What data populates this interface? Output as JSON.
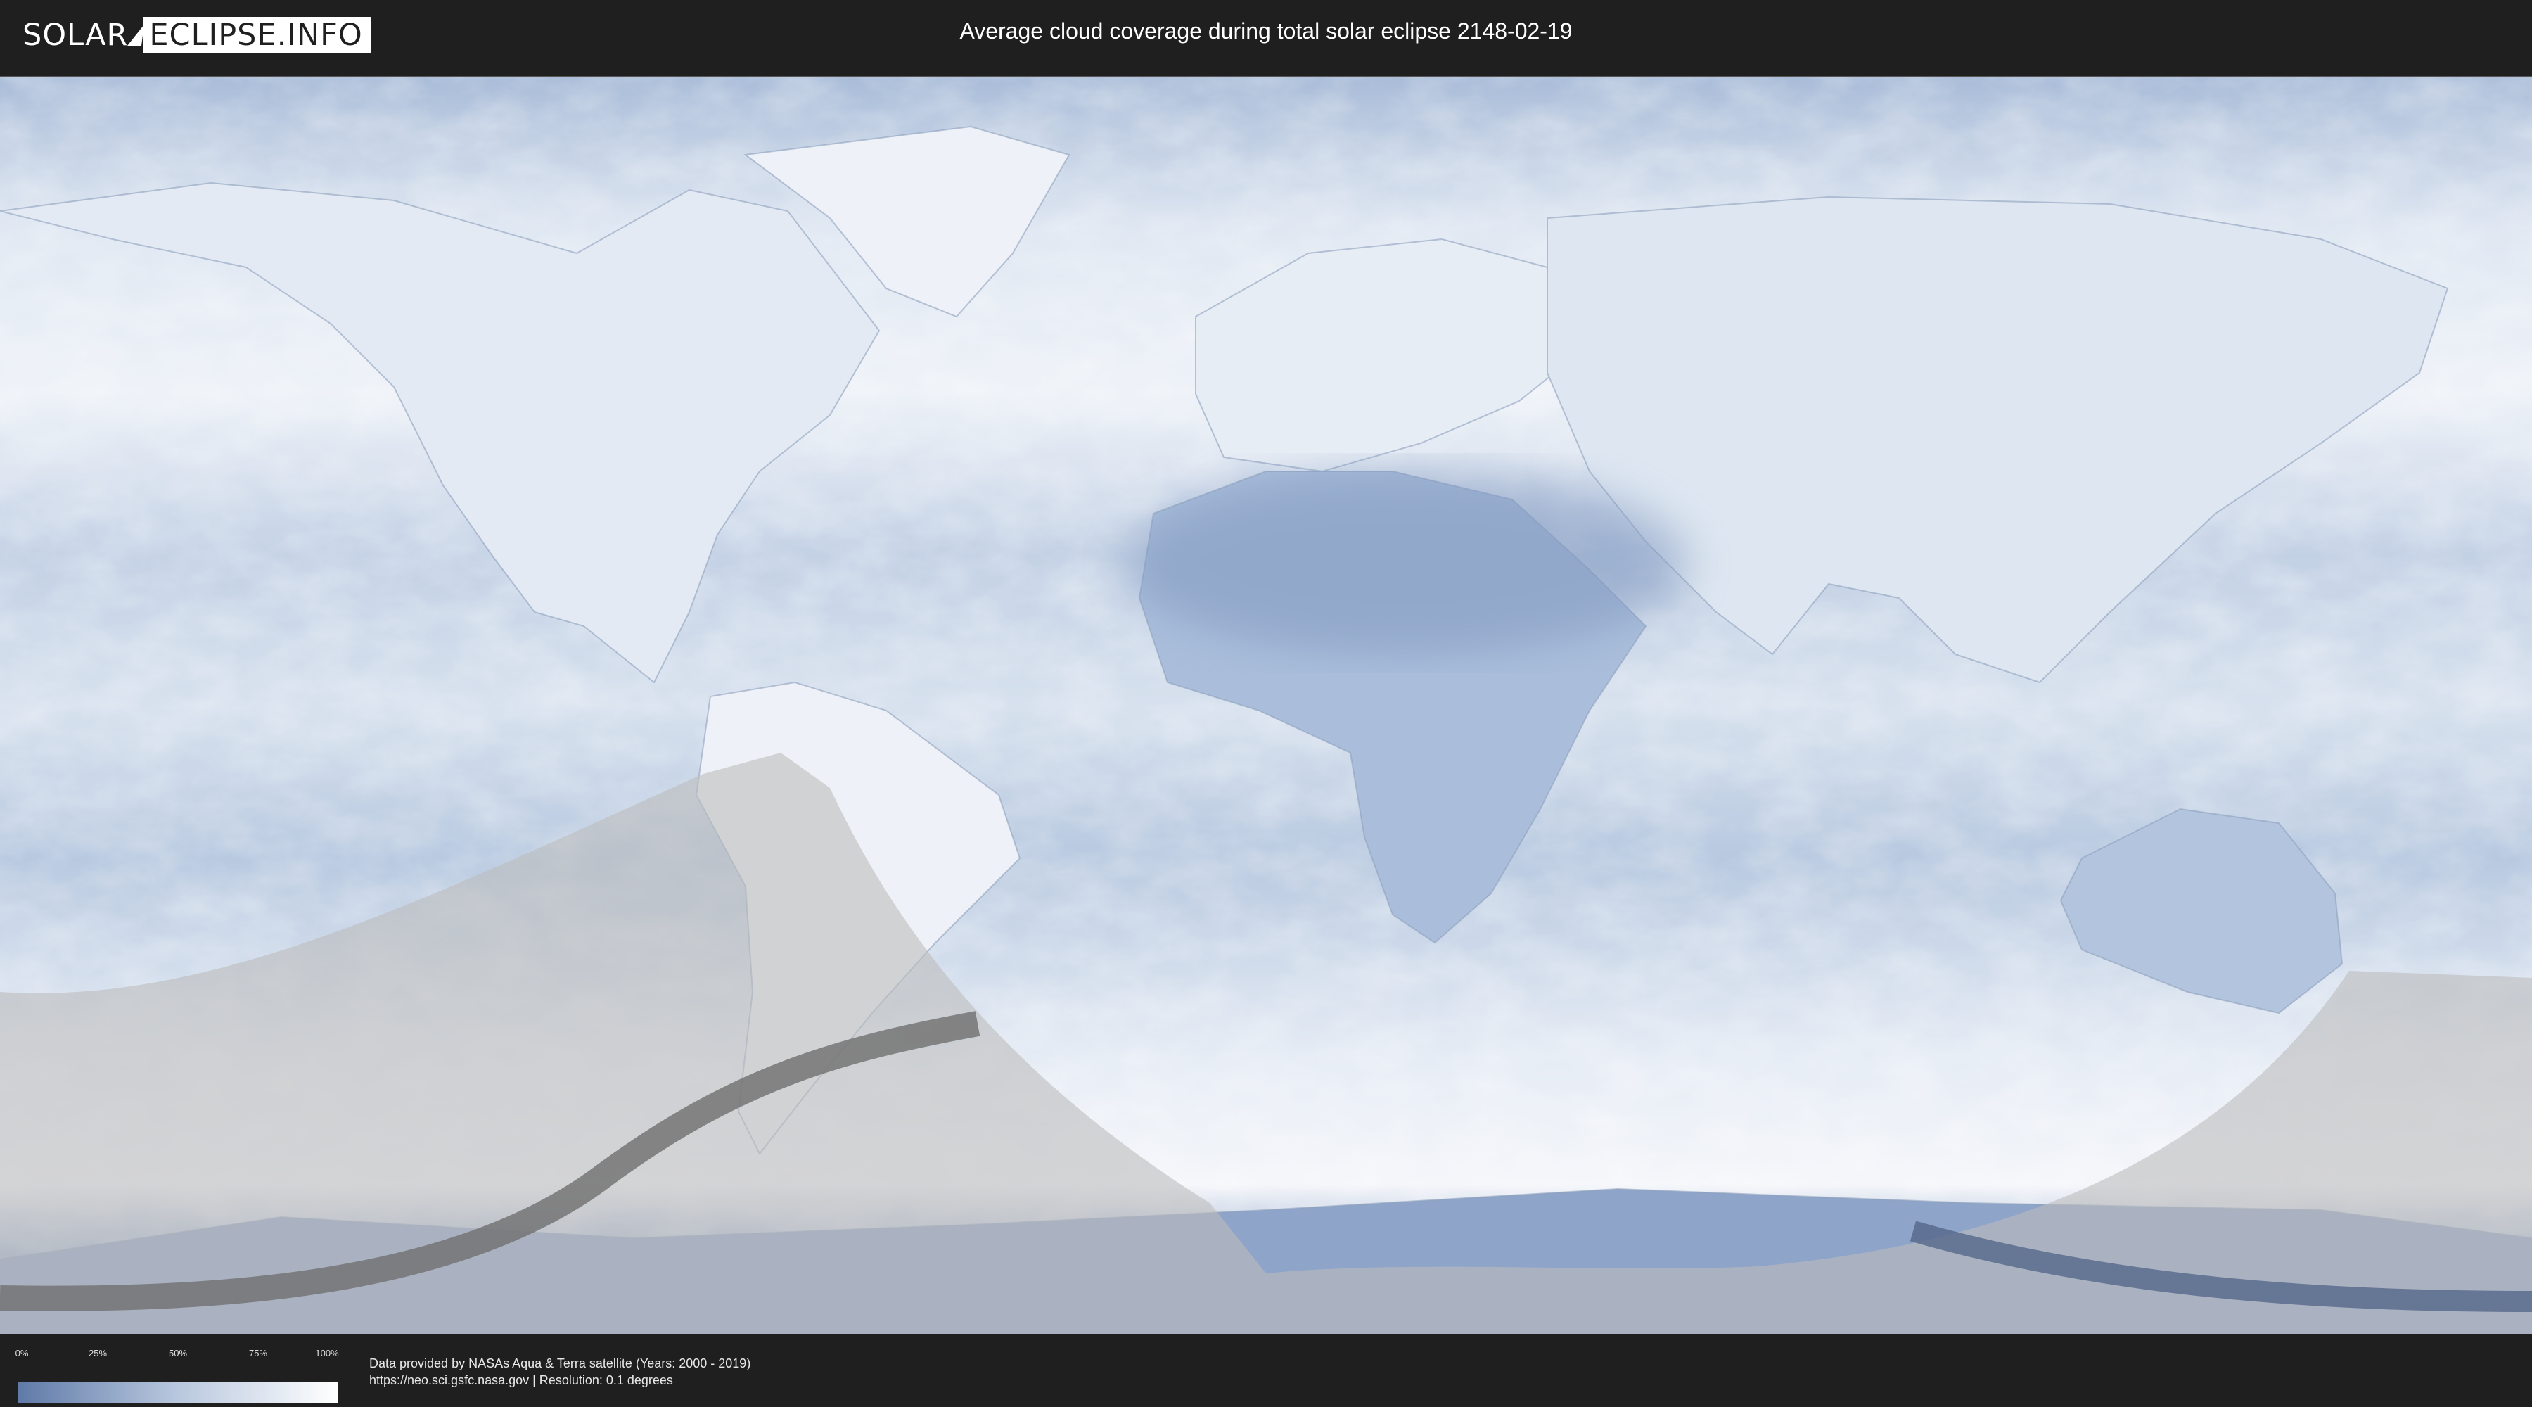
{
  "header": {
    "logo_solar": "SOLAR",
    "logo_eclipse": "ECLIPSE.INFO",
    "title": "Average cloud coverage during total solar eclipse 2148-02-19"
  },
  "legend": {
    "ticks": [
      "0%",
      "25%",
      "50%",
      "75%",
      "100%"
    ],
    "gradient": [
      "#5f7aa8",
      "#b9c8de",
      "#ffffff"
    ]
  },
  "credits": {
    "line1": "Data provided by NASAs Aqua & Terra satellite (Years: 2000 - 2019)",
    "line2": "https://neo.sci.gsfc.nasa.gov | Resolution: 0.1 degrees"
  },
  "colors": {
    "ocean_cloud": "#c9d6e8",
    "clear_sky": "#7f97bf",
    "overcast": "#f2f5fa",
    "penumbra_shade": "#bdbdbd",
    "totality_path": "#6f6f6f"
  }
}
